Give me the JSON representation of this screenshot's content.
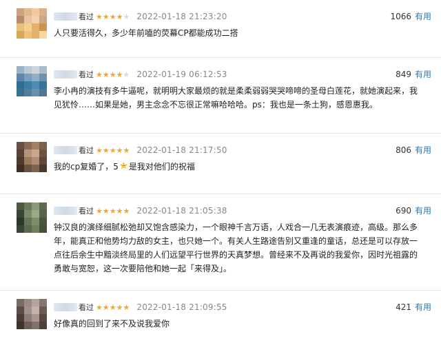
{
  "reviews": [
    {
      "seen_label": "看过",
      "stars": 4,
      "time": "2022-01-18 21:23:20",
      "votes": "1066",
      "useful_label": "有用",
      "text": "人只要活得久，多少年前嗑的荧幕CP都能成功二搭"
    },
    {
      "seen_label": "看过",
      "stars": 4,
      "time": "2022-01-19 06:12:53",
      "votes": "849",
      "useful_label": "有用",
      "text": "李小冉的演技有多牛逼呢，就明明大家最烦的就是柔柔弱弱哭哭啼啼的圣母白莲花，就她演起来，我见犹怜……如果是她，男主念念不忘很正常嘛哈哈哈。ps：我也是一条土狗，感恩惠我。"
    },
    {
      "seen_label": "看过",
      "stars": 5,
      "time": "2022-01-18 21:17:50",
      "votes": "806",
      "useful_label": "有用",
      "text_before": "我的cp复婚了，5",
      "text_after": "是我对他们的祝福"
    },
    {
      "seen_label": "看过",
      "stars": 5,
      "time": "2022-01-18 21:05:38",
      "votes": "690",
      "useful_label": "有用",
      "text": "钟汉良的演绎细腻松弛却又饱含感染力，一个眼神千言万语，人戏合一几无表演痕迹，高级。那么多年，能真正和他势均力敌的女主，也只她一个。有关人生路途告别又重逢的童话，总还是可以存放一点往后余生中黯淡终局里的人们远望平行世界的天真梦想。曾经来不及再说的我爱你，因时光祖露的勇敢与宽恕，这一次要陪他和她一起「来得及」。"
    },
    {
      "seen_label": "看过",
      "stars": 5,
      "time": "2022-01-18 21:09:55",
      "votes": "421",
      "useful_label": "有用",
      "text": "好像真的回到了来不及说我爱你"
    }
  ],
  "colors": {
    "star": "#f5a623",
    "useful_link": "#3377aa",
    "time": "#888888"
  }
}
